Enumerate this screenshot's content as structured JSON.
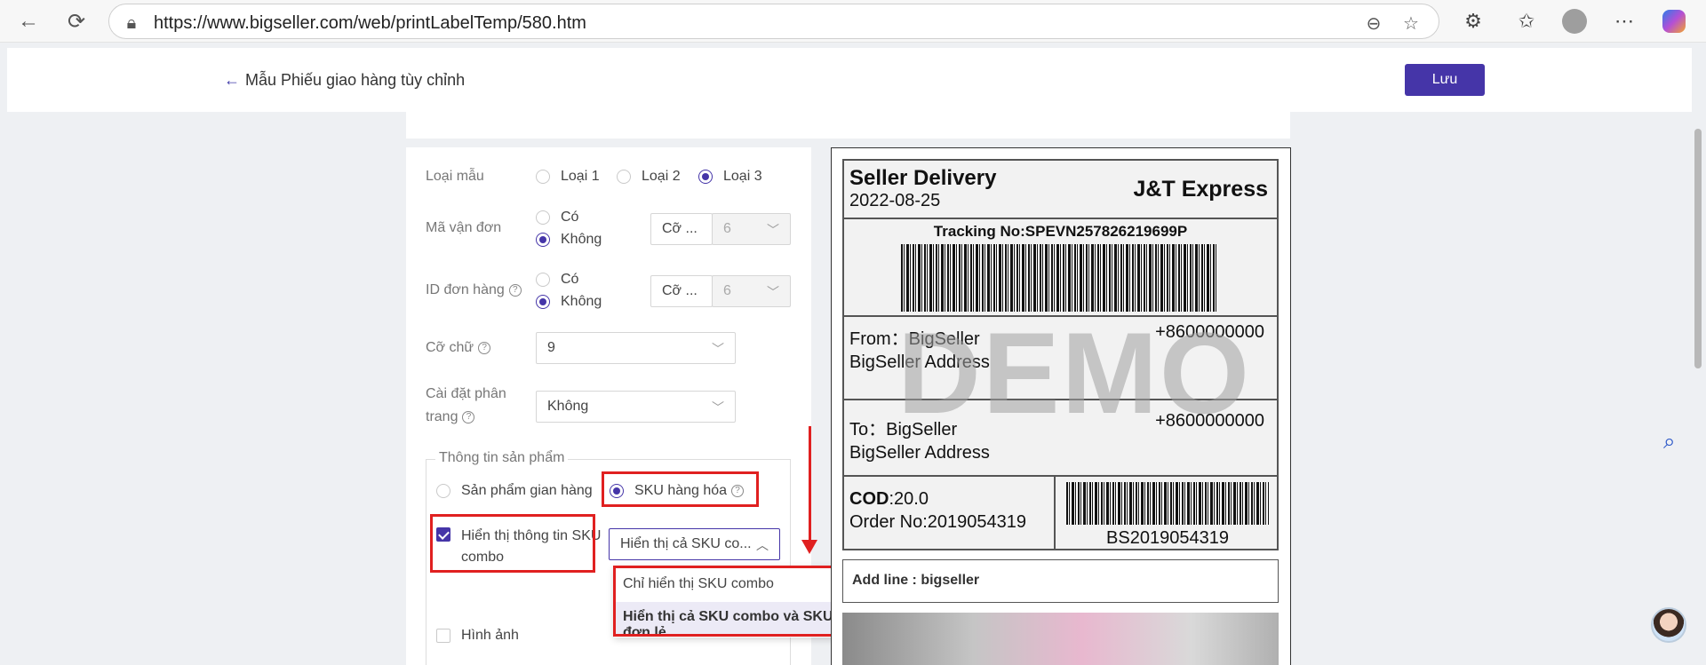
{
  "browser": {
    "url": "https://www.bigseller.com/web/printLabelTemp/580.htm"
  },
  "header": {
    "back_label": "Mẫu Phiếu giao hàng tùy chỉnh",
    "save_label": "Lưu"
  },
  "form": {
    "template_type": {
      "label": "Loại mẫu",
      "options": [
        "Loại 1",
        "Loại 2",
        "Loại 3"
      ],
      "selected": "Loại 3"
    },
    "tracking_code": {
      "label": "Mã vận đơn",
      "yes": "Có",
      "no": "Không",
      "size_placeholder": "Cỡ ...",
      "size_value": "6"
    },
    "order_id": {
      "label": "ID đơn hàng",
      "yes": "Có",
      "no": "Không",
      "size_placeholder": "Cỡ ...",
      "size_value": "6"
    },
    "font_size": {
      "label": "Cỡ chữ",
      "value": "9"
    },
    "pagination": {
      "label_line1": "Cài đặt phân",
      "label_line2": "trang",
      "value": "Không"
    },
    "product_info": {
      "legend": "Thông tin sản phẩm",
      "option_store": "Sản phẩm gian hàng",
      "option_sku": "SKU hàng hóa",
      "combo_check_line1": "Hiển thị thông tin SKU",
      "combo_check_line2": "combo",
      "combo_select_value": "Hiển thị cả SKU co...",
      "dropdown_options": [
        "Chỉ hiển thị SKU combo",
        "Hiển thị cả SKU combo và SKU đơn lẻ"
      ],
      "image_label": "Hình ảnh"
    }
  },
  "preview": {
    "title": "Seller Delivery",
    "date": "2022-08-25",
    "carrier": "J&T Express",
    "tracking": "Tracking No:SPEVN257826219699P",
    "from_label": "From：BigSeller",
    "from_phone": "+8600000000",
    "from_address": "BigSeller Address",
    "to_label": "To：BigSeller",
    "to_phone": "+8600000000",
    "to_address": "BigSeller Address",
    "cod_key": "COD",
    "cod_value": ":20.0",
    "order_no": "Order No:2019054319",
    "barcode_text": "BS2019054319",
    "watermark": "DEMO",
    "add_line": "Add line : bigseller"
  }
}
